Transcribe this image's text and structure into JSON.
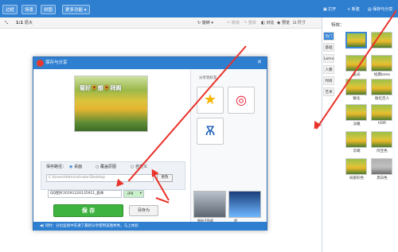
{
  "topbar": {
    "tabs": [
      "边框",
      "场景",
      "拼图",
      "更多功能 ▾"
    ],
    "open": "打开",
    "new": "新建",
    "save_share": "保存与分享",
    "more": "更多"
  },
  "toolbar": {
    "zoom": "1:1",
    "zoom_label": "原大",
    "rotate": "旋转",
    "undo": "撤销",
    "redo": "重做",
    "compare": "对比",
    "preview": "预览",
    "size": "尺寸"
  },
  "right_panel": {
    "title": "特效：",
    "categories": [
      "热门",
      "基础",
      "Lomo",
      "人像",
      "时尚",
      "艺术"
    ],
    "thumbs": [
      {
        "label": "",
        "selected": true
      },
      {
        "label": ""
      },
      {
        "label": "柔光"
      },
      {
        "label": "经典lomo"
      },
      {
        "label": "暖化"
      },
      {
        "label": "粉红佳人"
      },
      {
        "label": "淡雅"
      },
      {
        "label": "HDR"
      },
      {
        "label": "云端"
      },
      {
        "label": "阿宝色"
      },
      {
        "label": "局部彩色"
      },
      {
        "label": "黑白色"
      }
    ]
  },
  "dialog": {
    "title": "保存与分享",
    "photo_caption": "菊好🌻想🌻拜阁",
    "share_title": "分享到好友",
    "save_path_label": "保存路径：",
    "path_options": [
      "桌面",
      "覆盖原图",
      "自定义"
    ],
    "path_value": "C:\\Users\\Administrator\\Desktop",
    "change_button": "更改",
    "filename": "QQ图片20191220135911_副本",
    "format": ".jpg",
    "save_button": "保 存",
    "save_as_button": "另存为",
    "ad_label_1": "钢电子防窥",
    "ad_label_2": "喷",
    "footer": "同时：分位监视中先请了最新分享使用美图秀秀，马上体验"
  },
  "colors": {
    "brand_blue": "#2f7fd1",
    "save_green": "#3fb33f",
    "arrow_red": "#e8332a"
  }
}
